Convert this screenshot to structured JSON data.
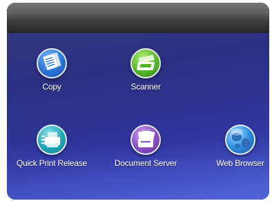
{
  "apps": [
    {
      "id": "copy",
      "label": "Copy",
      "icon": "copy-icon",
      "color": "#2b74d6"
    },
    {
      "id": "scanner",
      "label": "Scanner",
      "icon": "scanner-icon",
      "color": "#56b62a"
    },
    {
      "id": "quick-print-release",
      "label": "Quick Print Release",
      "icon": "quick-print-release-icon",
      "color": "#21a6b8"
    },
    {
      "id": "document-server",
      "label": "Document Server",
      "icon": "document-server-icon",
      "color": "#8a4fc4"
    },
    {
      "id": "web-browser",
      "label": "Web Browser",
      "icon": "globe-icon",
      "color": "#2f8ee0"
    }
  ],
  "theme": {
    "background": "#2c2f80",
    "top_bar": "#3e3e3e",
    "label_color": "#ffffff"
  }
}
